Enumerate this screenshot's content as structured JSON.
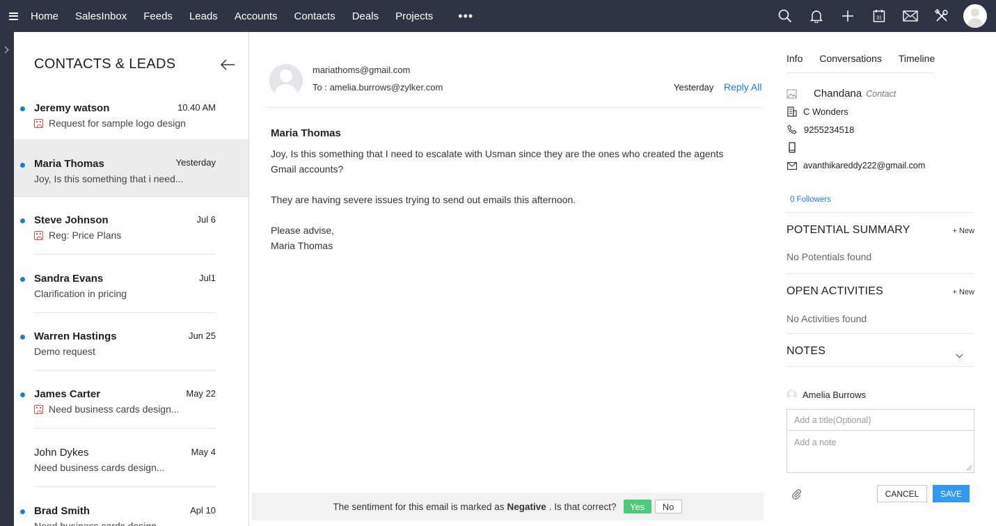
{
  "nav": {
    "items": [
      {
        "label": "Home"
      },
      {
        "label": "SalesInbox"
      },
      {
        "label": "Feeds"
      },
      {
        "label": "Leads"
      },
      {
        "label": "Accounts"
      },
      {
        "label": "Contacts"
      },
      {
        "label": "Deals"
      },
      {
        "label": "Projects"
      }
    ],
    "more": "•••",
    "icons": [
      "search-icon",
      "bell-icon",
      "plus-icon",
      "calendar-icon",
      "mail-icon",
      "tools-icon"
    ],
    "calendar_day": "31"
  },
  "list": {
    "title": "CONTACTS & LEADS",
    "items": [
      {
        "name": "Jeremy watson",
        "date": "10.40 AM",
        "subject": "Request for sample logo design",
        "unread": true,
        "negative": true
      },
      {
        "name": "Maria Thomas",
        "date": "Yesterday",
        "subject": "Joy, Is this something that i need...",
        "unread": true,
        "negative": false
      },
      {
        "name": "Steve Johnson",
        "date": "Jul 6",
        "subject": "Reg: Price Plans",
        "unread": true,
        "negative": true
      },
      {
        "name": "Sandra Evans",
        "date": "Jul1",
        "subject": "Clarification in pricing",
        "unread": true,
        "negative": false
      },
      {
        "name": "Warren Hastings",
        "date": "Jun 25",
        "subject": "Demo request",
        "unread": true,
        "negative": false
      },
      {
        "name": "James Carter",
        "date": "May 22",
        "subject": "Need business cards design...",
        "unread": true,
        "negative": true
      },
      {
        "name": "John Dykes",
        "date": "May 4",
        "subject": "Need business cards design...",
        "unread": false,
        "negative": false
      },
      {
        "name": "Brad Smith",
        "date": "Apl 10",
        "subject": "Need business cards design...",
        "unread": true,
        "negative": false
      }
    ]
  },
  "email": {
    "from": "mariathoms@gmail.com",
    "to": "To : amelia.burrows@zylker.com",
    "when": "Yesterday",
    "reply_all": "Reply All",
    "sender": "Maria Thomas",
    "body": [
      "Joy, Is this something that I need to escalate with Usman since they are the ones who created the agents Gmail accounts?",
      "They are having severe issues trying to send out emails this afternoon.",
      "Please advise,",
      "Maria Thomas"
    ],
    "sentiment": {
      "prefix": "The sentiment for this email is marked as",
      "value": "Negative",
      "suffix": ". Is that correct?",
      "yes": "Yes",
      "no": "No"
    }
  },
  "info": {
    "tabs": [
      "Info",
      "Conversations",
      "Timeline"
    ],
    "contact": {
      "name": "Chandana",
      "type": "Contact",
      "company": "C Wonders",
      "phone": "9255234518",
      "mobile": "",
      "email": "avanthikareddy222@gmail.com"
    },
    "followers": "0 Followers",
    "potential": {
      "title": "POTENTIAL SUMMARY",
      "new": "+ New",
      "empty": "No Potentials found"
    },
    "activities": {
      "title": "OPEN ACTIVITIES",
      "new": "+ New",
      "empty": "No Activities found"
    },
    "notes": {
      "title": "NOTES",
      "user": "Amelia Burrows",
      "title_placeholder": "Add a title(Optional)",
      "note_placeholder": "Add a note",
      "cancel": "CANCEL",
      "save": "SAVE"
    }
  },
  "colors": {
    "topbar": "#2e3444",
    "accent": "#1e7bd6",
    "negative": "#e24a4a",
    "yes": "#4cc97a",
    "save": "#3399ee"
  }
}
